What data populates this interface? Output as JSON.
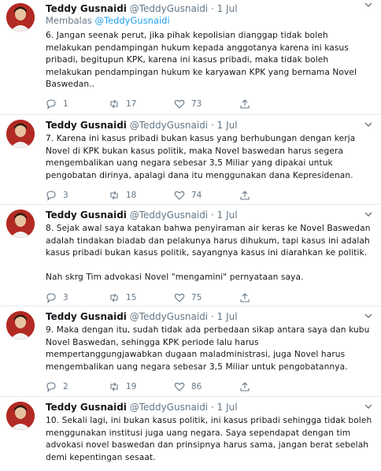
{
  "tweets": [
    {
      "name": "Teddy Gusnaidi",
      "handle": "@TeddyGusnaidi",
      "dot": "·",
      "time": "1 Jul",
      "reply_prefix": "Membalas ",
      "reply_to": "@TeddyGusnaidi",
      "text": "6. Jangan seenak perut, jika pihak kepolisian dianggap tidak boleh\nmelakukan pendampingan hukum kepada anggotanya karena ini kasus\npribadi, begitupun KPK, karena ini kasus pribadi, maka tidak boleh\nmelakukan pendampingan hukum ke karyawan KPK yang bernama Novel\nBaswedan..",
      "replies": "1",
      "retweets": "17",
      "likes": "73"
    },
    {
      "name": "Teddy Gusnaidi",
      "handle": "@TeddyGusnaidi",
      "dot": "·",
      "time": "1 Jul",
      "text": "7. Karena ini kasus pribadi bukan kasus yang berhubungan dengan kerja\nNovel di KPK bukan kasus politik, maka Novel baswedan harus segera\nmengembalikan uang negara sebesar 3,5 Miliar yang dipakai untuk\npengobatan dirinya, apalagi dana itu menggunakan dana Kepresidenan.",
      "replies": "3",
      "retweets": "18",
      "likes": "74"
    },
    {
      "name": "Teddy Gusnaidi",
      "handle": "@TeddyGusnaidi",
      "dot": "·",
      "time": "1 Jul",
      "text": "8. Sejak awal saya katakan bahwa penyiraman air keras ke Novel Baswedan\nadalah tindakan biadab dan pelakunya harus dihukum, tapi kasus ini adalah\nkasus pribadi bukan kasus politik, sayangnya kasus ini diarahkan ke politik.\n\nNah skrg Tim advokasi Novel \"mengamini\" pernyataan saya.",
      "replies": "3",
      "retweets": "15",
      "likes": "75"
    },
    {
      "name": "Teddy Gusnaidi",
      "handle": "@TeddyGusnaidi",
      "dot": "·",
      "time": "1 Jul",
      "text": "9. Maka dengan itu, sudah tidak ada perbedaan sikap antara saya dan kubu\nNovel Baswedan, sehingga KPK periode lalu harus\nmempertanggungjawabkan dugaan maladministrasi, juga Novel harus\nmengembalikan uang negara sebesar 3,5 Miliar untuk pengobatannya.",
      "replies": "2",
      "retweets": "19",
      "likes": "86"
    },
    {
      "name": "Teddy Gusnaidi",
      "handle": "@TeddyGusnaidi",
      "dot": "·",
      "time": "1 Jul",
      "text": "10. Sekali lagi, ini bukan kasus politik, ini kasus pribadi sehingga tidak boleh\nmenggunakan institusi juga uang negara. Saya sependapat dengan tim\nadvokasi novel baswedan dan prinsipnya harus sama, jangan berat sebelah\ndemi kepentingan sesaat."
    }
  ],
  "colors": {
    "text": "#14171a",
    "secondary": "#657786",
    "link": "#1da1f2",
    "divider": "#e6ecf0",
    "avatar_bg": "#b22a23"
  },
  "icons": [
    "chevron-down-icon",
    "reply-icon",
    "retweet-icon",
    "like-icon",
    "share-icon"
  ]
}
